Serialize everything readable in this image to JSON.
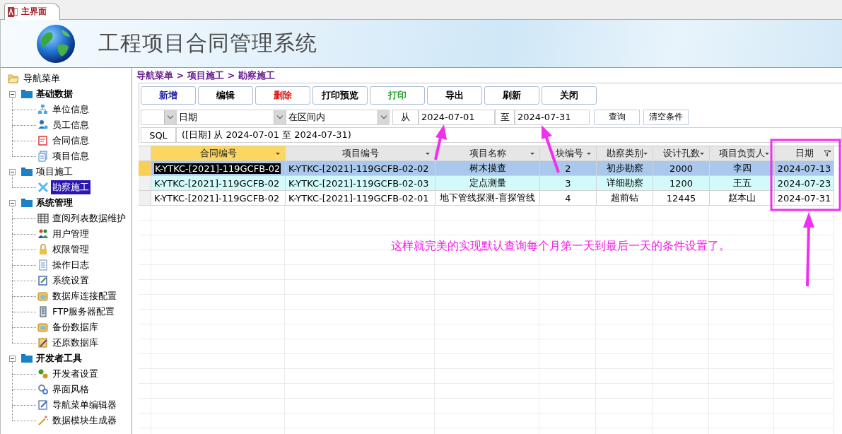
{
  "document_tab": {
    "label": "主界面",
    "selected": true
  },
  "banner": {
    "title": "工程项目合同管理系统"
  },
  "sidebar": {
    "root": "导航菜单",
    "items": [
      {
        "label": "基础数据",
        "bold": true,
        "expanded": true,
        "children": [
          {
            "label": "单位信息",
            "selected": false
          },
          {
            "label": "员工信息",
            "selected": false
          },
          {
            "label": "合同信息",
            "selected": false
          },
          {
            "label": "项目信息",
            "selected": false
          }
        ]
      },
      {
        "label": "项目施工",
        "bold": false,
        "expanded": true,
        "children": [
          {
            "label": "勘察施工",
            "selected": true
          }
        ]
      },
      {
        "label": "系统管理",
        "bold": true,
        "expanded": true,
        "children": [
          {
            "label": "查阅列表数据维护",
            "selected": false
          },
          {
            "label": "用户管理",
            "selected": false
          },
          {
            "label": "权限管理",
            "selected": false
          },
          {
            "label": "操作日志",
            "selected": false
          },
          {
            "label": "系统设置",
            "selected": false
          },
          {
            "label": "数据库连接配置",
            "selected": false
          },
          {
            "label": "FTP服务器配置",
            "selected": false
          },
          {
            "label": "备份数据库",
            "selected": false
          },
          {
            "label": "还原数据库",
            "selected": false
          }
        ]
      },
      {
        "label": "开发者工具",
        "bold": true,
        "expanded": true,
        "children": [
          {
            "label": "开发者设置",
            "selected": false
          },
          {
            "label": "界面风格",
            "selected": false
          },
          {
            "label": "导航菜单编辑器",
            "selected": false
          },
          {
            "label": "数据模块生成器",
            "selected": false
          }
        ]
      }
    ]
  },
  "breadcrumb": "导航菜单 > 项目施工 > 勘察施工",
  "buttons": [
    {
      "label": "新增",
      "color": "#1c1ca8"
    },
    {
      "label": "编辑",
      "color": "#000000"
    },
    {
      "label": "删除",
      "color": "#e01818"
    },
    {
      "label": "打印预览",
      "color": "#000000"
    },
    {
      "label": "打印",
      "color": "#2aa02a"
    },
    {
      "label": "导出",
      "color": "#000000"
    },
    {
      "label": "刷新",
      "color": "#000000"
    },
    {
      "label": "关闭",
      "color": "#000000"
    }
  ],
  "filter": {
    "field": "日期",
    "operator": "在区间内",
    "from_label": "从",
    "from": "2024-07-01",
    "to_label": "至",
    "to": "2024-07-31",
    "buttons": [
      "查询",
      "清空条件"
    ]
  },
  "sql": {
    "label": "SQL",
    "value": "([日期] 从 2024-07-01 至 2024-07-31)"
  },
  "table": {
    "columns": [
      {
        "label": "合同编号",
        "selected": true,
        "filtered": false
      },
      {
        "label": "项目编号",
        "selected": false,
        "filtered": false
      },
      {
        "label": "项目名称",
        "selected": false,
        "filtered": false
      },
      {
        "label": "块编号",
        "selected": false,
        "filtered": false
      },
      {
        "label": "勘察类别",
        "selected": false,
        "filtered": false
      },
      {
        "label": "设计孔数",
        "selected": false,
        "filtered": false
      },
      {
        "label": "项目负责人",
        "selected": false,
        "filtered": false
      },
      {
        "label": "日期",
        "selected": false,
        "filtered": true
      }
    ],
    "rows": [
      {
        "selected": true,
        "color": "#a9c8ec",
        "cells": [
          "K-YTKC-[2021]-119GCFB-02",
          "K-YTKC-[2021]-119GCFB-02-02",
          "树木摸查",
          "2",
          "初步勘察",
          "2000",
          "李四",
          "2024-07-13"
        ]
      },
      {
        "selected": false,
        "color": "#d2fafa",
        "cells": [
          "K-YTKC-[2021]-119GCFB-02",
          "K-YTKC-[2021]-119GCFB-02-03",
          "定点测量",
          "3",
          "详细勘察",
          "1200",
          "王五",
          "2024-07-23"
        ]
      },
      {
        "selected": false,
        "color": "#ffffff",
        "cells": [
          "K-YTKC-[2021]-119GCFB-02",
          "K-YTKC-[2021]-119GCFB-02-01",
          "地下管线探测-盲探管线",
          "4",
          "超前钻",
          "12445",
          "赵本山",
          "2024-07-31"
        ]
      }
    ]
  },
  "annotation": {
    "note": "这样就完美的实现默认查询每个月第一天到最后一天的条件设置了。"
  }
}
